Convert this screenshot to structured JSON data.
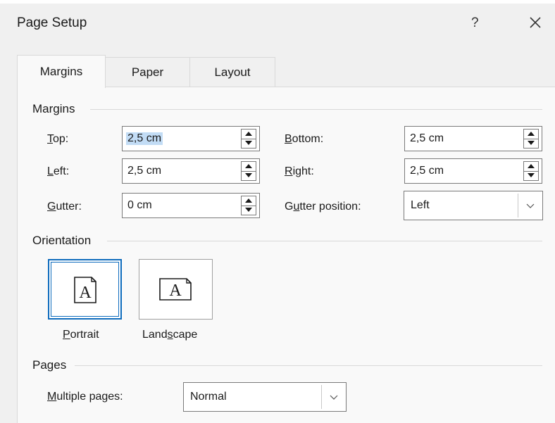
{
  "window": {
    "title": "Page Setup",
    "help_label": "?"
  },
  "tabs": [
    {
      "label": "Margins",
      "active": true
    },
    {
      "label": "Paper",
      "active": false
    },
    {
      "label": "Layout",
      "active": false
    }
  ],
  "margins": {
    "heading": "Margins",
    "top": {
      "first": "T",
      "rest": "op:",
      "value": "2,5 cm"
    },
    "left": {
      "first": "L",
      "rest": "eft:",
      "value": "2,5 cm"
    },
    "gutter": {
      "first": "G",
      "rest": "utter:",
      "value": "0 cm"
    },
    "bottom": {
      "first": "B",
      "rest": "ottom:",
      "value": "2,5 cm"
    },
    "right": {
      "pre": "R",
      "rest": "ight:",
      "value": "2,5 cm"
    },
    "gutter_position": {
      "pre": "G",
      "mid": "u",
      "rest": "tter position:",
      "value": "Left"
    }
  },
  "orientation": {
    "heading": "Orientation",
    "portrait": {
      "first": "P",
      "rest": "ortrait",
      "glyph": "A",
      "selected": true
    },
    "landscape": {
      "pre": "Land",
      "mid": "s",
      "rest": "cape",
      "glyph": "A",
      "selected": false
    }
  },
  "pages": {
    "heading": "Pages",
    "multiple_pages": {
      "first": "M",
      "rest": "ultiple pages:",
      "value": "Normal"
    }
  },
  "colors": {
    "accent": "#0f6cbd",
    "selection": "#c2dcf5",
    "panel_bg": "#f9f9f9",
    "dialog_bg": "#f0f0f0"
  }
}
